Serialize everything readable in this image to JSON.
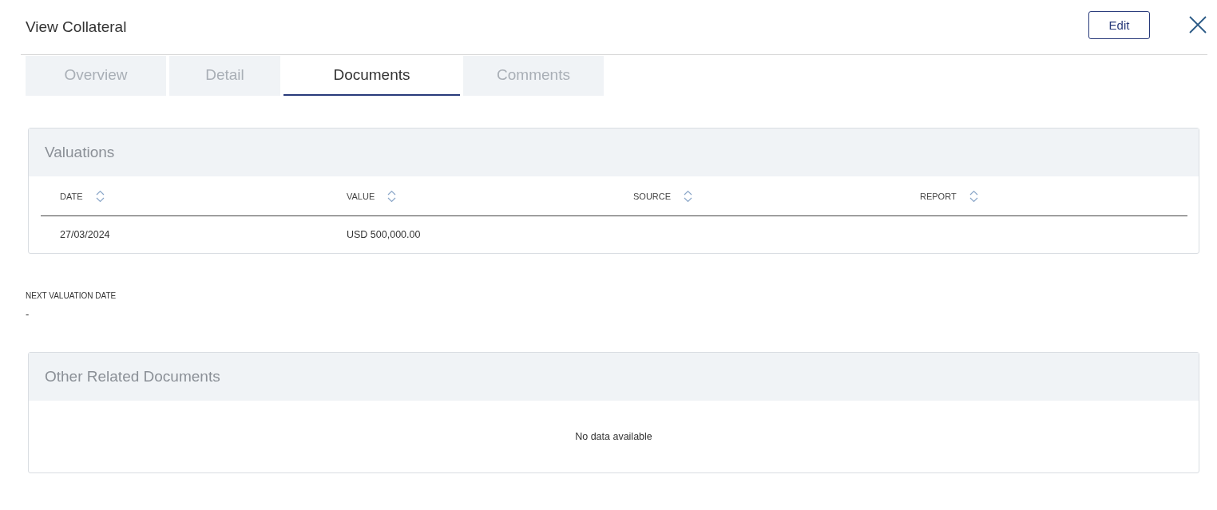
{
  "header": {
    "title": "View Collateral",
    "edit_button": "Edit"
  },
  "tabs": [
    {
      "label": "Overview",
      "selected": false
    },
    {
      "label": "Detail",
      "selected": false
    },
    {
      "label": "Documents",
      "selected": true
    },
    {
      "label": "Comments",
      "selected": false
    }
  ],
  "valuations": {
    "title": "Valuations",
    "columns": [
      "DATE",
      "VALUE",
      "SOURCE",
      "REPORT"
    ],
    "rows": [
      [
        "27/03/2024",
        "USD 500,000.00",
        "",
        ""
      ]
    ]
  },
  "next_valuation": {
    "label": "NEXT VALUATION DATE",
    "value": "-"
  },
  "other_documents": {
    "title": "Other Related Documents",
    "empty_message": "No data available"
  }
}
